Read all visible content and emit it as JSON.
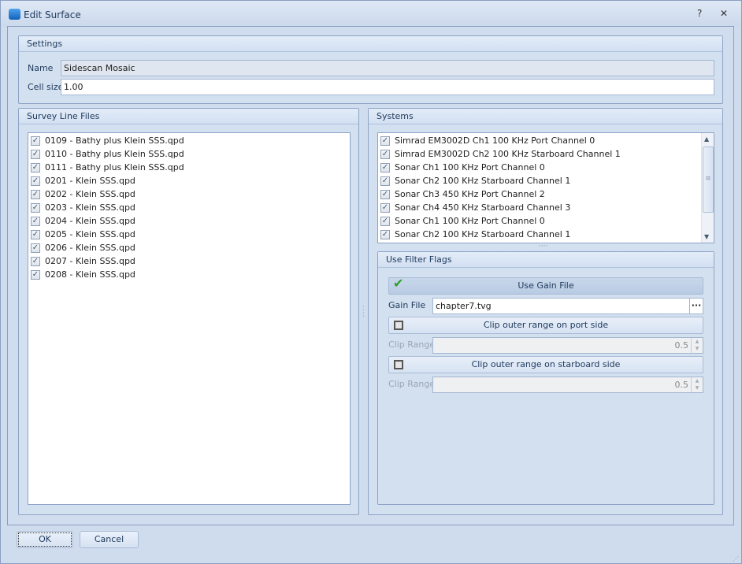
{
  "window": {
    "title": "Edit Surface",
    "help_icon": "?",
    "close_icon": "✕"
  },
  "settings": {
    "header": "Settings",
    "name_label": "Name",
    "name_value": "Sidescan Mosaic",
    "cell_label": "Cell size",
    "cell_value": "1.00"
  },
  "survey": {
    "header": "Survey Line Files",
    "files": [
      "0109 - Bathy plus Klein SSS.qpd",
      "0110 - Bathy plus Klein SSS.qpd",
      "0111 - Bathy plus Klein SSS.qpd",
      "0201 - Klein SSS.qpd",
      "0202 - Klein SSS.qpd",
      "0203 - Klein SSS.qpd",
      "0204 - Klein SSS.qpd",
      "0205 - Klein SSS.qpd",
      "0206 - Klein SSS.qpd",
      "0207 - Klein SSS.qpd",
      "0208 - Klein SSS.qpd"
    ]
  },
  "systems": {
    "header": "Systems",
    "items": [
      "Simrad EM3002D Ch1 100 KHz Port Channel 0",
      "Simrad EM3002D Ch2 100 KHz Starboard Channel 1",
      "Sonar Ch1 100 KHz Port Channel 0",
      "Sonar Ch2 100 KHz Starboard Channel 1",
      "Sonar Ch3 450 KHz Port Channel 2",
      "Sonar Ch4 450 KHz Starboard Channel 3",
      "Sonar Ch1 100 KHz Port Channel 0",
      "Sonar Ch2 100 KHz Starboard Channel 1"
    ]
  },
  "filter": {
    "header": "Use Filter Flags",
    "use_gain": "Use Gain File",
    "gain_label": "Gain File",
    "gain_value": "chapter7.tvg",
    "browse": "···",
    "clip_port": "Clip outer range on port side",
    "clip_label": "Clip Range",
    "clip_port_value": "0.5",
    "clip_stbd": "Clip outer range on starboard side",
    "clip_stbd_value": "0.5"
  },
  "buttons": {
    "ok": "OK",
    "cancel": "Cancel"
  }
}
